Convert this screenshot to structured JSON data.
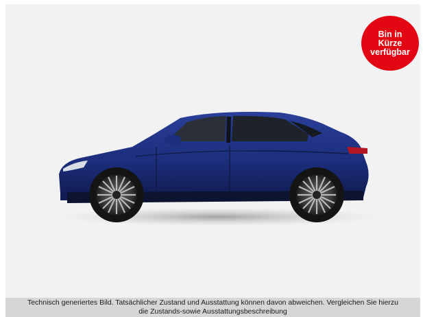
{
  "badge": {
    "line1": "Bin in",
    "line2": "Kürze",
    "line3": "verfügbar"
  },
  "image": {
    "subject_icon": "car-side-view-icon",
    "car_color": "#1c2e7c",
    "badge_color": "#e30613",
    "background_color": "#f2f2f2"
  },
  "caption": {
    "line1": "Technisch generiertes Bild. Tatsächlicher Zustand und Ausstattung können davon abweichen. Vergleichen Sie hierzu",
    "line2": "die Zustands-sowie Ausstattungsbeschreibung"
  }
}
